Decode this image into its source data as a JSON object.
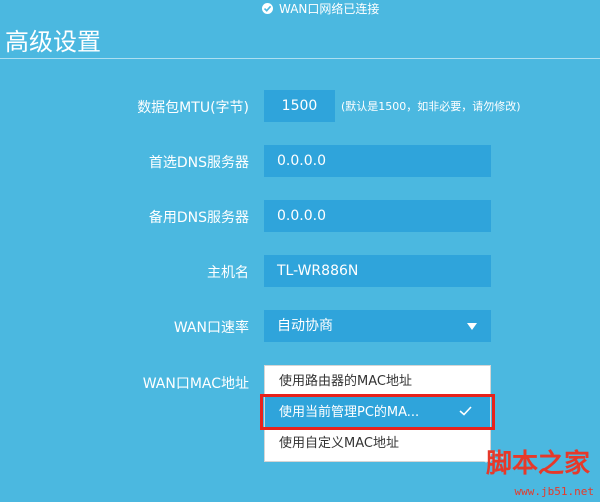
{
  "status": {
    "text": "WAN口网络已连接",
    "icon": "check-circle-icon"
  },
  "page_title": "高级设置",
  "fields": {
    "mtu": {
      "label": "数据包MTU(字节)",
      "value": "1500",
      "hint": "(默认是1500，如非必要，请勿修改)"
    },
    "dns_primary": {
      "label": "首选DNS服务器",
      "value": "0.0.0.0"
    },
    "dns_secondary": {
      "label": "备用DNS服务器",
      "value": "0.0.0.0"
    },
    "hostname": {
      "label": "主机名",
      "value": "TL-WR886N"
    },
    "wan_speed": {
      "label": "WAN口速率",
      "value": "自动协商"
    },
    "wan_mac": {
      "label": "WAN口MAC地址",
      "options": [
        "使用路由器的MAC地址",
        "使用当前管理PC的MA...",
        "使用自定义MAC地址"
      ],
      "selected_index": 1
    }
  },
  "watermark": {
    "text": "脚本之家",
    "url": "www.jb51.net"
  },
  "colors": {
    "background": "#4bb8e0",
    "field": "#2fa4db",
    "highlight": "#e8221b"
  }
}
